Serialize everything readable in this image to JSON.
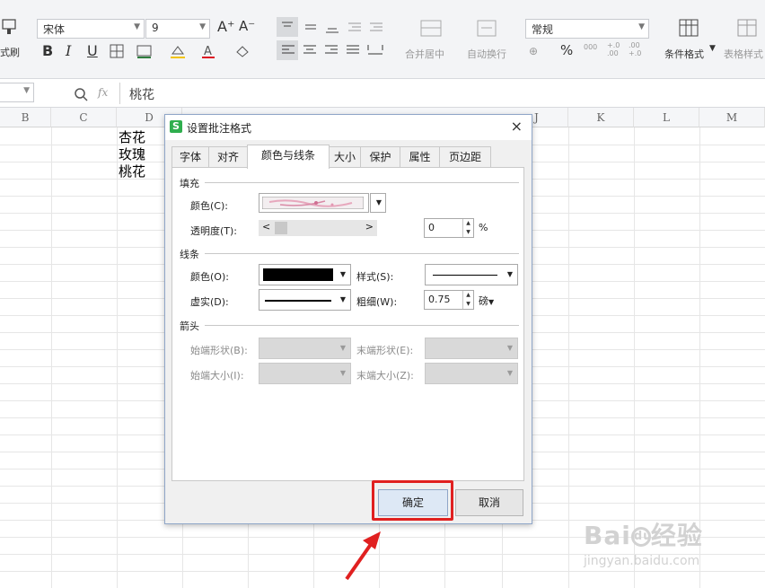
{
  "ribbon": {
    "format_painter_label": "式刷",
    "font_name": "宋体",
    "font_size": "9",
    "font_grow_icon": "A⁺",
    "font_shrink_icon": "A⁻",
    "bold": "B",
    "italic": "I",
    "underline": "U",
    "merge_center": "合并居中",
    "auto_wrap": "自动换行",
    "number_format": "常规",
    "percent": "%",
    "thousands": "000",
    "inc_decimal": "+.0 .00",
    "dec_decimal": ".00 +.0",
    "conditional_format": "条件格式",
    "table_style": "表格样式"
  },
  "formula_bar": {
    "fx": "fx",
    "value": "桃花"
  },
  "sheet": {
    "columns": [
      "B",
      "C",
      "D",
      "J",
      "K",
      "L",
      "M"
    ],
    "cells": [
      "杏花",
      "玫瑰",
      "桃花"
    ]
  },
  "dialog": {
    "title": "设置批注格式",
    "close": "×",
    "tabs": [
      "字体",
      "对齐",
      "颜色与线条",
      "大小",
      "保护",
      "属性",
      "页边距"
    ],
    "active_tab": "颜色与线条",
    "fill": {
      "section": "填充",
      "color_label": "颜色(C):",
      "transparency_label": "透明度(T):",
      "transparency_value": "0",
      "percent": "%"
    },
    "line": {
      "section": "线条",
      "color_label": "颜色(O):",
      "style_label": "样式(S):",
      "dash_label": "虚实(D):",
      "weight_label": "粗细(W):",
      "weight_value": "0.75",
      "unit": "磅"
    },
    "arrow": {
      "section": "箭头",
      "begin_style": "始端形状(B):",
      "end_style": "末端形状(E):",
      "begin_size": "始端大小(I):",
      "end_size": "末端大小(Z):"
    },
    "ok": "确定",
    "cancel": "取消"
  },
  "watermark": {
    "brand": "Bai",
    "brand2": "du",
    "brand3": "经验",
    "url": "jingyan.baidu.com"
  },
  "colors": {
    "accent": "#2fae4e",
    "highlight": "#e02020",
    "ok_bg": "#dde8f5"
  }
}
